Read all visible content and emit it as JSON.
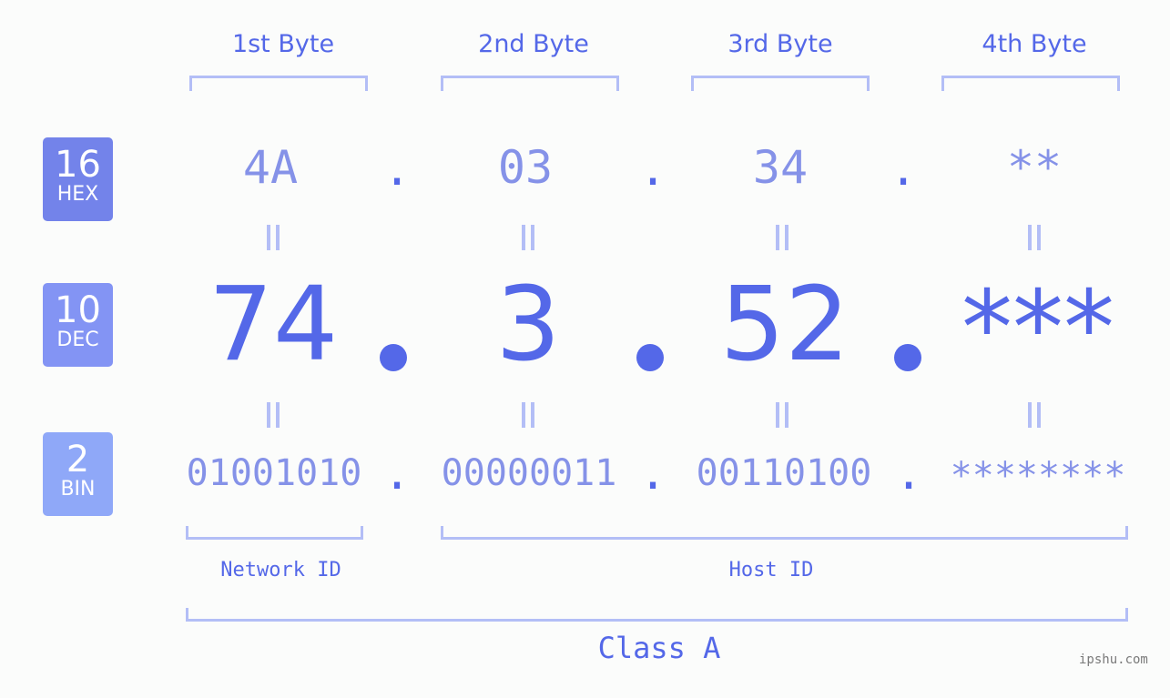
{
  "headers": [
    "1st Byte",
    "2nd Byte",
    "3rd Byte",
    "4th Byte"
  ],
  "badges": {
    "hex": {
      "num": "16",
      "label": "HEX",
      "color": "#7383ea"
    },
    "dec": {
      "num": "10",
      "label": "DEC",
      "color": "#8394f4"
    },
    "bin": {
      "num": "2",
      "label": "BIN",
      "color": "#8fa8f8"
    }
  },
  "hex_values": [
    "4A",
    "03",
    "34",
    "**"
  ],
  "dec_values": [
    "74",
    "3",
    "52",
    "***"
  ],
  "bin_values": [
    "01001010",
    "00000011",
    "00110100",
    "********"
  ],
  "separator": ".",
  "labels": {
    "network": "Network ID",
    "host": "Host ID",
    "class": "Class A"
  },
  "watermark": "ipshu.com",
  "colors": {
    "primary": "#5468e8",
    "secondary": "#8592e8",
    "bracket": "#b3bef6"
  }
}
